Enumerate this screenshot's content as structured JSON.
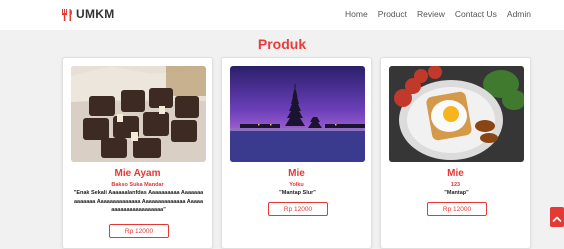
{
  "navbar": {
    "brand": "UMKM",
    "links": [
      "Home",
      "Product",
      "Review",
      "Contact Us",
      "Admin"
    ]
  },
  "section": {
    "title": "Produk"
  },
  "products": [
    {
      "name": "Mie Ayam",
      "subtitle": "Bakso Suka Mandar",
      "description": "\"Enak Sekali Aaaaaalanfdas Aaaaaaaaaa Aaaaaaaaaaaaaa Aaaaaaaaaaaaaa Aaaaaaaaaaaaaa Aaaaaaaaaaaaaaaaaaaaaa\"",
      "price": "Rp 12000",
      "image_icon": "chocolate-image"
    },
    {
      "name": "Mie",
      "subtitle": "Yolku",
      "description": "\"Mantap Slur\"",
      "price": "Rp 12000",
      "image_icon": "temple-image"
    },
    {
      "name": "Mie",
      "subtitle": "123",
      "description": "\"Mantap\"",
      "price": "Rp 12000",
      "image_icon": "breakfast-image"
    }
  ],
  "colors": {
    "accent": "#e53935",
    "navbar_bg": "#ffffff",
    "page_bg": "#f1f1f1"
  }
}
